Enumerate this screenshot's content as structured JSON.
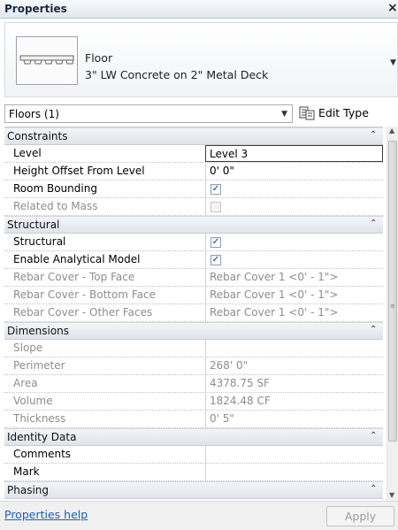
{
  "window": {
    "title": "Properties",
    "close": "×"
  },
  "type": {
    "name": "Floor",
    "description": "3\" LW Concrete on 2\" Metal Deck",
    "dropdown": "▼"
  },
  "selector": {
    "value": "Floors (1)",
    "arrow": "▼"
  },
  "edit_type": {
    "label": "Edit Type",
    "icon": "edit-type-icon"
  },
  "groups": {
    "constraints": "Constraints",
    "structural": "Structural",
    "dimensions": "Dimensions",
    "identity": "Identity Data",
    "phasing": "Phasing",
    "collapse_glyph": "⌃"
  },
  "props": {
    "level": {
      "name": "Level",
      "value": "Level 3"
    },
    "height_offset": {
      "name": "Height Offset From Level",
      "value": "0'  0\""
    },
    "room_bounding": {
      "name": "Room Bounding",
      "checked": true
    },
    "related_to_mass": {
      "name": "Related to Mass",
      "checked": false
    },
    "structural": {
      "name": "Structural",
      "checked": true
    },
    "enable_analytical": {
      "name": "Enable Analytical Model",
      "checked": true
    },
    "rebar_top": {
      "name": "Rebar Cover - Top Face",
      "value": "Rebar Cover 1 <0' - 1\">"
    },
    "rebar_bottom": {
      "name": "Rebar Cover - Bottom Face",
      "value": "Rebar Cover 1 <0' - 1\">"
    },
    "rebar_other": {
      "name": "Rebar Cover - Other Faces",
      "value": "Rebar Cover 1 <0' - 1\">"
    },
    "slope": {
      "name": "Slope",
      "value": ""
    },
    "perimeter": {
      "name": "Perimeter",
      "value": "268'  0\""
    },
    "area": {
      "name": "Area",
      "value": "4378.75 SF"
    },
    "volume": {
      "name": "Volume",
      "value": "1824.48 CF"
    },
    "thickness": {
      "name": "Thickness",
      "value": "0'  5\""
    },
    "comments": {
      "name": "Comments",
      "value": ""
    },
    "mark": {
      "name": "Mark",
      "value": ""
    }
  },
  "check_glyph": "✓",
  "footer": {
    "help": "Properties help",
    "apply": "Apply"
  },
  "colors": {
    "link": "#1a5fb4",
    "disabled_text": "#8d8d8d",
    "group_bg": "#e6eaef"
  }
}
